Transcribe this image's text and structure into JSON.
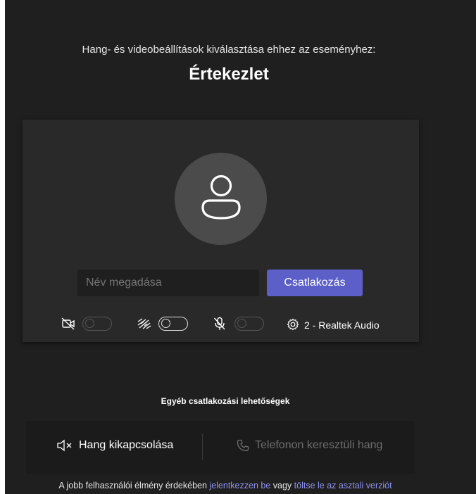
{
  "header": {
    "subtitle": "Hang- és videobeállítások kiválasztása ehhez az eseményhez:",
    "meeting_title": "Értekezlet"
  },
  "prejoin": {
    "name_placeholder": "Név megadása",
    "join_label": "Csatlakozás",
    "device_label": "2 - Realtek Audio",
    "toggles": {
      "camera": "off",
      "background_blur": "off",
      "microphone": "off"
    }
  },
  "other_options": {
    "title": "Egyéb csatlakozási lehetőségek",
    "audio_off_label": "Hang kikapcsolása",
    "phone_audio_label": "Telefonon keresztüli hang"
  },
  "footer": {
    "prefix": "A jobb felhasználói élmény érdekében ",
    "sign_in_link": "jelentkezzen be",
    "middle": " vagy ",
    "download_link": "töltse le az asztali verziót"
  },
  "colors": {
    "background": "#1f1f1f",
    "panel": "#292929",
    "accent": "#5b5fc7",
    "link": "#8f93f0"
  }
}
